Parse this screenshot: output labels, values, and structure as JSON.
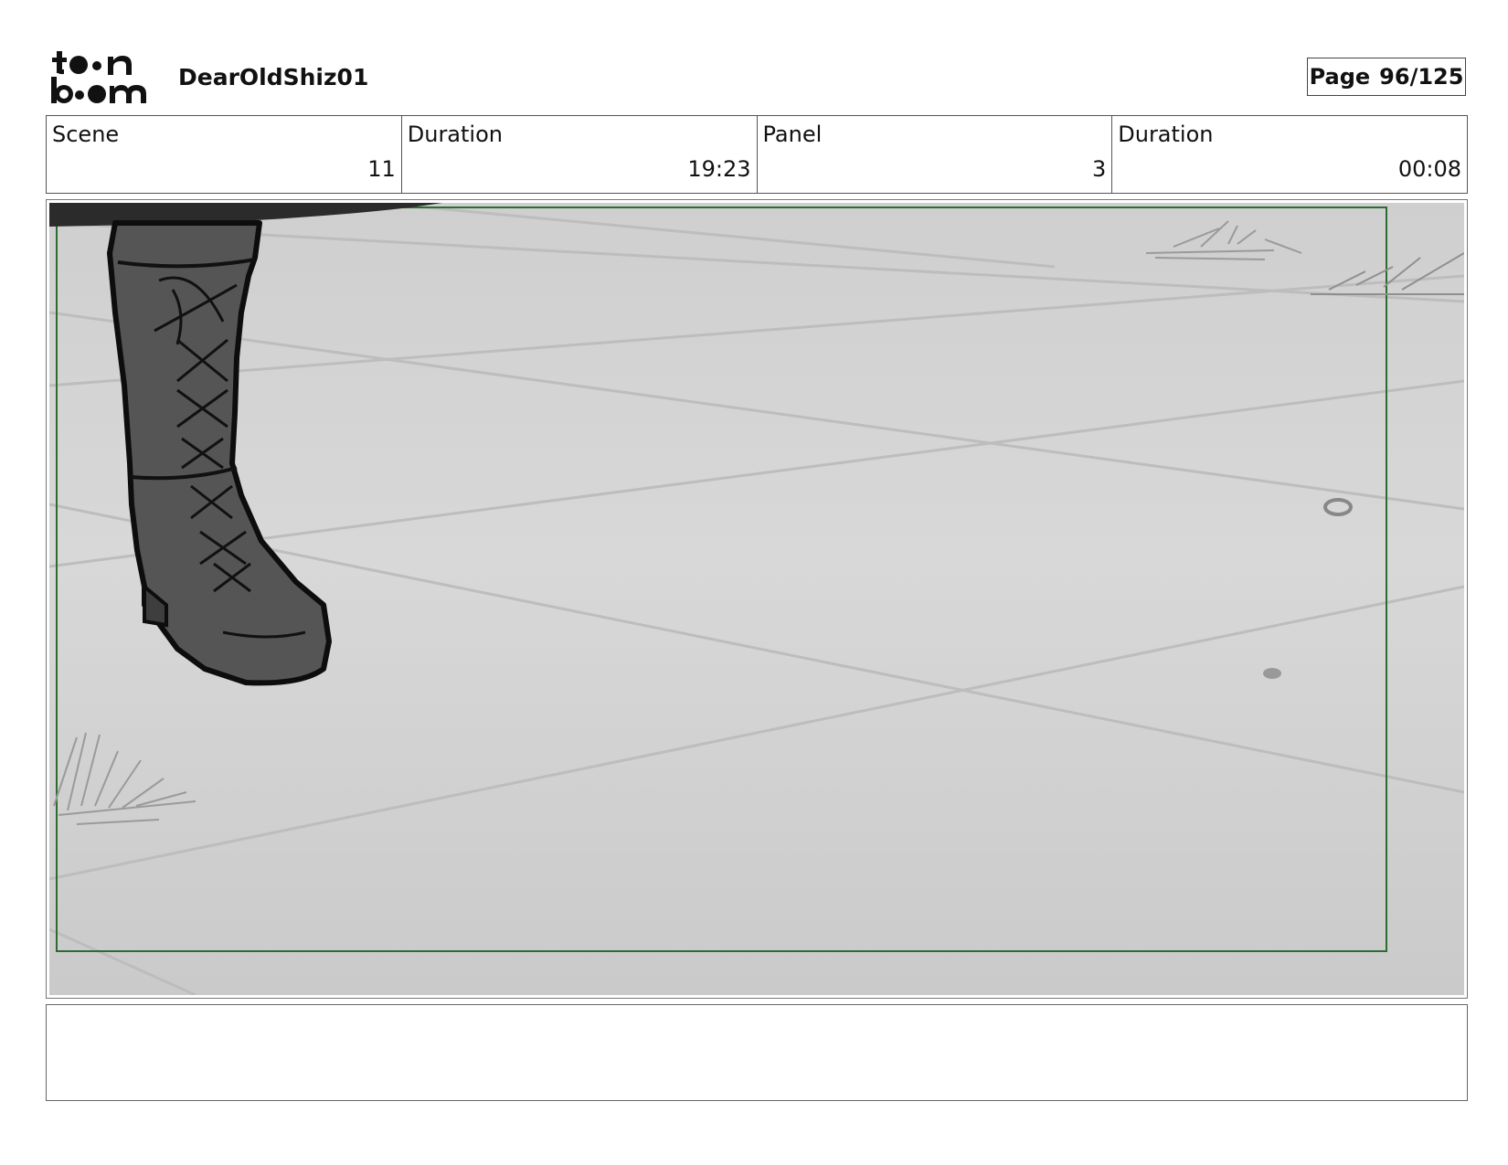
{
  "header": {
    "logo_text_top": "toon",
    "logo_text_bottom": "boom",
    "project_title": "DearOldShiz01",
    "page_label": "Page",
    "page_number": "96/125"
  },
  "info": {
    "scene_label": "Scene",
    "scene_value": "11",
    "scene_duration_label": "Duration",
    "scene_duration_value": "19:23",
    "panel_label": "Panel",
    "panel_value": "3",
    "panel_duration_label": "Duration",
    "panel_duration_value": "00:08"
  },
  "notes": {
    "text": ""
  }
}
